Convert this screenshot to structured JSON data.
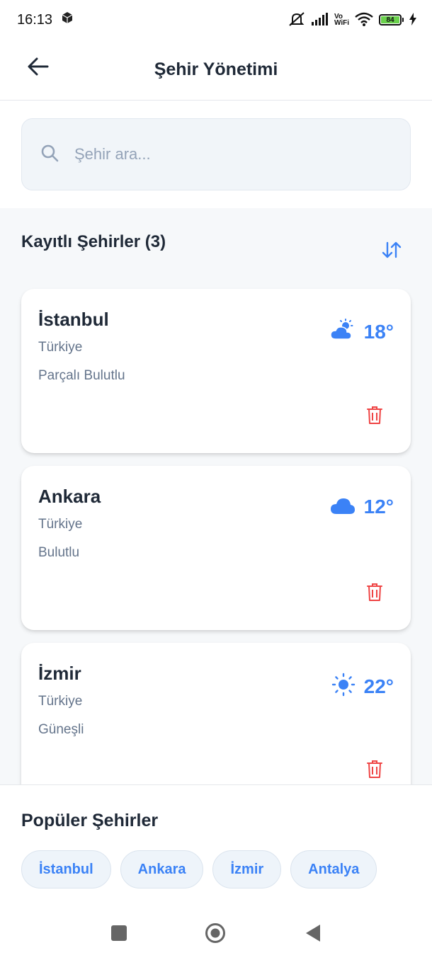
{
  "status_bar": {
    "time": "16:13",
    "vo_label": "Vo",
    "wifi_label": "WiFi",
    "battery": "84"
  },
  "app_bar": {
    "title": "Şehir Yönetimi"
  },
  "search": {
    "placeholder": "Şehir ara..."
  },
  "saved": {
    "title": "Kayıtlı Şehirler (3)",
    "cities": [
      {
        "name": "İstanbul",
        "country": "Türkiye",
        "condition": "Parçalı Bulutlu",
        "temp": "18°",
        "icon": "partly-cloudy-icon"
      },
      {
        "name": "Ankara",
        "country": "Türkiye",
        "condition": "Bulutlu",
        "temp": "12°",
        "icon": "cloud-icon"
      },
      {
        "name": "İzmir",
        "country": "Türkiye",
        "condition": "Güneşli",
        "temp": "22°",
        "icon": "sun-icon"
      }
    ]
  },
  "popular": {
    "title": "Popüler Şehirler",
    "chips": [
      "İstanbul",
      "Ankara",
      "İzmir",
      "Antalya"
    ]
  },
  "colors": {
    "accent": "#3b82f6",
    "delete": "#ef4444",
    "battery": "#6ad14c"
  }
}
